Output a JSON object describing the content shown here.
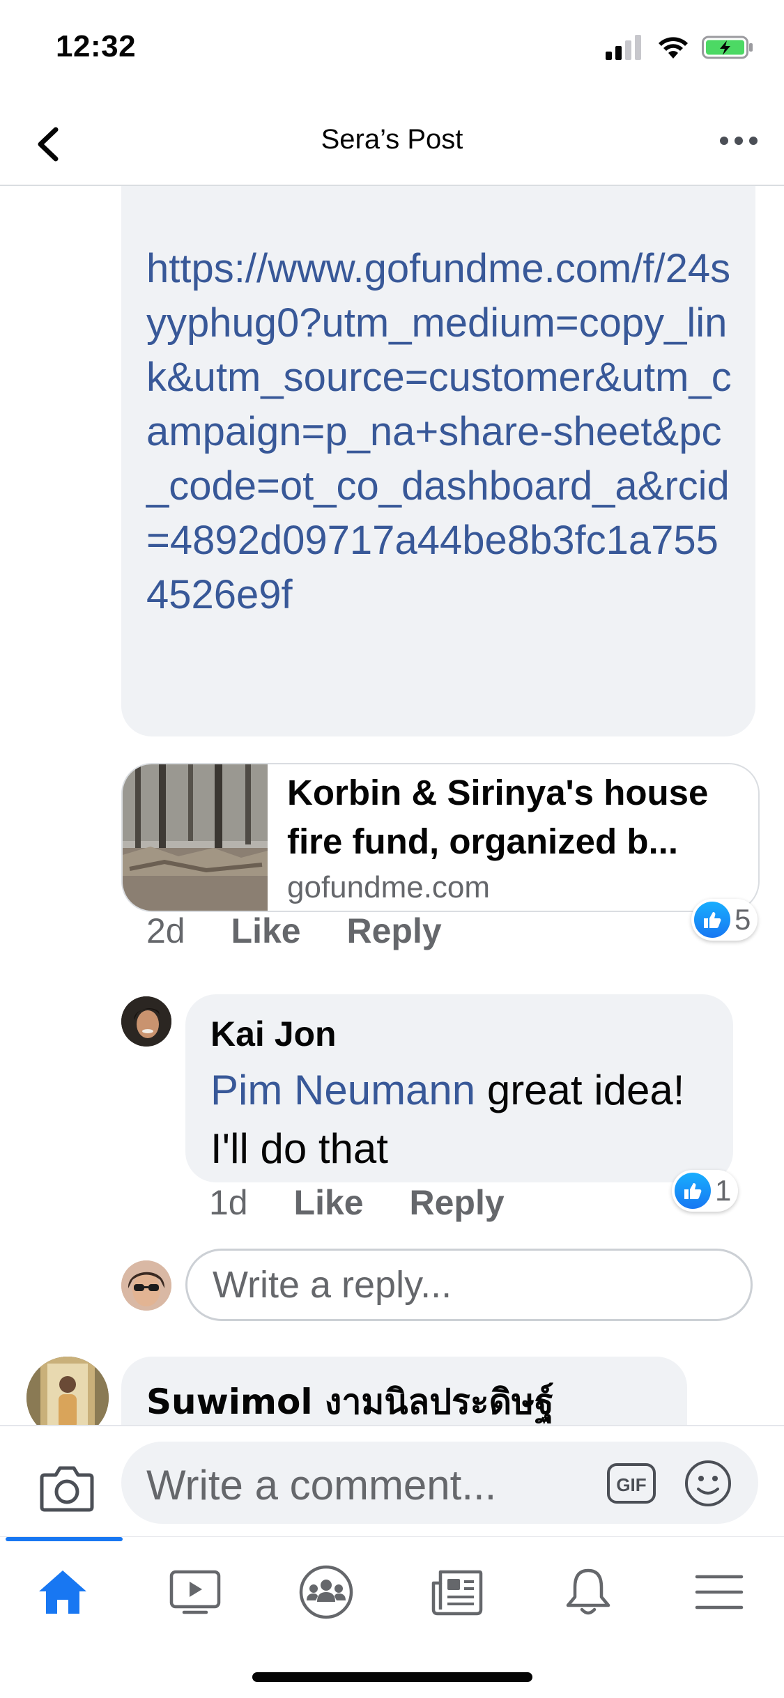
{
  "status_bar": {
    "time": "12:32"
  },
  "header": {
    "title": "Sera’s Post"
  },
  "link_comment": {
    "url_text": "https://www.gofundme.com/f/24syyphug0?utm_medium=copy_link&utm_source=customer&utm_campaign=p_na+share-sheet&pc_code=ot_co_dashboard_a&rcid=4892d09717a44be8b3fc1a7554526e9f",
    "preview": {
      "title": "Korbin & Sirinya's house fire fund, organized b...",
      "domain": "gofundme.com"
    },
    "time": "2d",
    "like_label": "Like",
    "reply_label": "Reply",
    "reaction_count": "5"
  },
  "reply": {
    "author": "Kai Jon",
    "mention": "Pim Neumann",
    "text": " great idea! I'll do that",
    "time": "1d",
    "like_label": "Like",
    "reply_label": "Reply",
    "reaction_count": "1"
  },
  "reply_input": {
    "placeholder": "Write a reply..."
  },
  "next_comment": {
    "author": "Suwimol งามนิลประดิษฐ์"
  },
  "composer": {
    "placeholder": "Write a comment...",
    "gif_label": "GIF"
  },
  "tabs": [
    {
      "name": "home-icon",
      "active": true
    },
    {
      "name": "watch-icon",
      "active": false
    },
    {
      "name": "groups-icon",
      "active": false
    },
    {
      "name": "news-icon",
      "active": false
    },
    {
      "name": "bell-icon",
      "active": false
    },
    {
      "name": "menu-icon",
      "active": false
    }
  ],
  "colors": {
    "accent": "#1877f2",
    "link": "#385898",
    "bubble": "#f0f2f5",
    "secondary_text": "#65676b"
  }
}
